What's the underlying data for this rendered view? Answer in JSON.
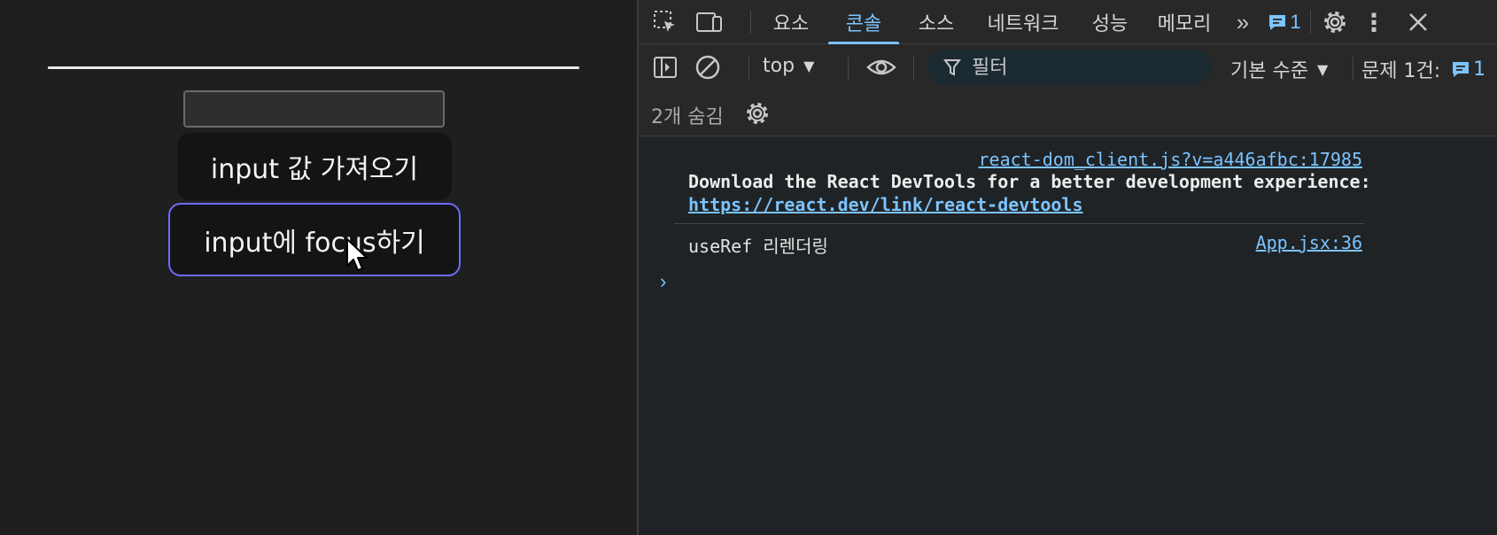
{
  "app": {
    "input": {
      "value": "",
      "placeholder": ""
    },
    "get_button_label": "input 값 가져오기",
    "focus_button_label": "input에 focus하기"
  },
  "devtools": {
    "tabs": [
      {
        "label": "요소",
        "active": false
      },
      {
        "label": "콘솔",
        "active": true
      },
      {
        "label": "소스",
        "active": false
      },
      {
        "label": "네트워크",
        "active": false
      },
      {
        "label": "성능",
        "active": false
      },
      {
        "label": "메모리",
        "active": false
      }
    ],
    "more_tabs_icon": "chevron-double-right-icon",
    "issues_badge_count": "1",
    "toolbar": {
      "context_label": "top",
      "filter_placeholder": "필터",
      "level_label": "기본 수준",
      "issues_label": "문제 1건:",
      "issues_count": "1",
      "hidden_label": "2개 숨김"
    },
    "console": {
      "messages": [
        {
          "source": "react-dom_client.js?v=a446afbc:17985",
          "text": "Download the React DevTools for a better development experience:",
          "link": "https://react.dev/link/react-devtools"
        },
        {
          "text": "useRef 리렌더링",
          "source": "App.jsx:36"
        }
      ],
      "prompt_symbol": "›"
    },
    "colors": {
      "accent": "#7cc3ff",
      "focus_border": "#6c6cff"
    }
  }
}
